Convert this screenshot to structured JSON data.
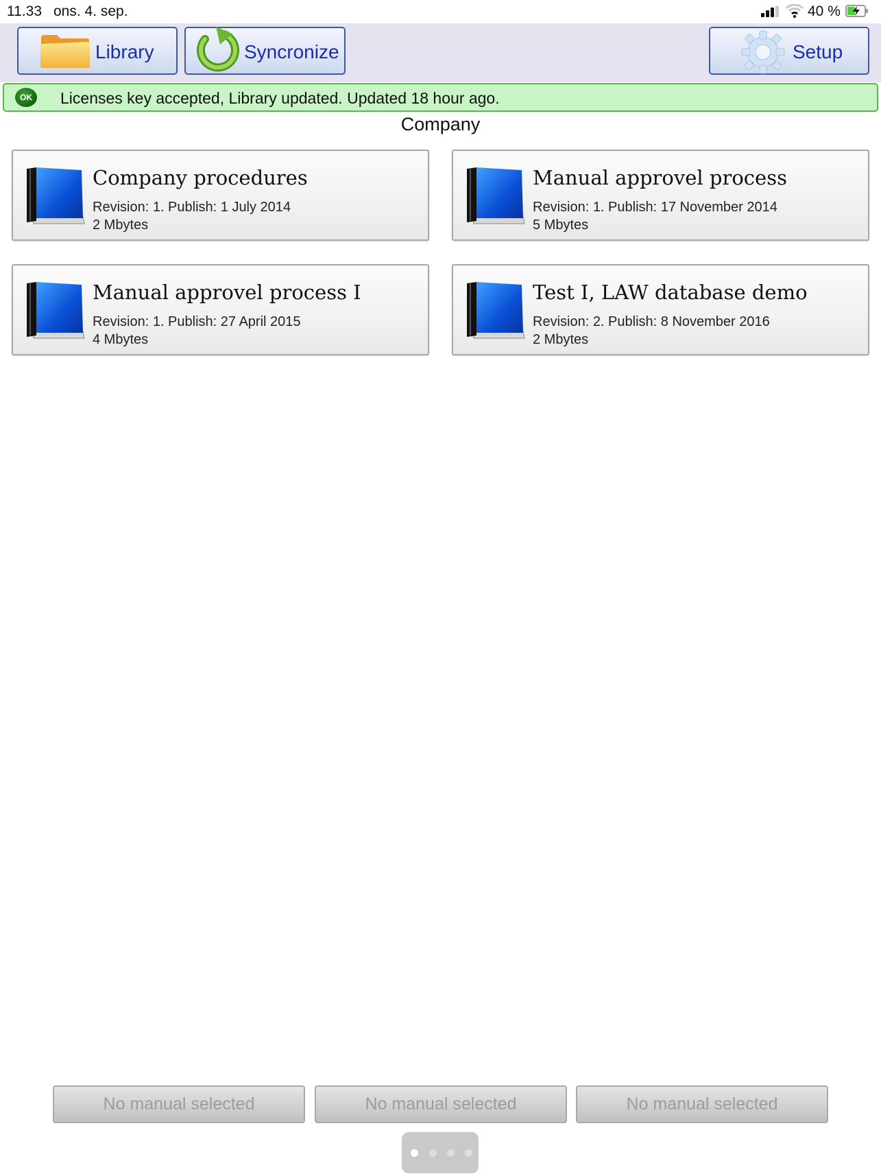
{
  "status_bar": {
    "time": "11.33",
    "date": "ons. 4. sep.",
    "battery": "40 %"
  },
  "toolbar": {
    "library_label": "Library",
    "sync_label": "Syncronize",
    "setup_label": "Setup"
  },
  "banner": {
    "badge": "OK",
    "message": "Licenses key accepted, Library updated. Updated 18 hour ago."
  },
  "section_title": "Company",
  "manuals": [
    {
      "title": "Company procedures",
      "revision": "Revision: 1. Publish: 1 July 2014",
      "size": "2 Mbytes"
    },
    {
      "title": "Manual approvel process",
      "revision": "Revision: 1. Publish: 17 November 2014",
      "size": "5 Mbytes"
    },
    {
      "title": "Manual approvel process I",
      "revision": "Revision: 1. Publish: 27 April 2015",
      "size": "4 Mbytes"
    },
    {
      "title": "Test I, LAW database demo",
      "revision": "Revision: 2. Publish: 8 November 2016",
      "size": "2 Mbytes"
    }
  ],
  "bottom_slots": [
    "No manual selected",
    "No manual selected",
    "No manual selected"
  ],
  "pager": {
    "pages": 4,
    "current": 1
  },
  "colors": {
    "accent_text": "#1a2fa5",
    "banner_bg": "#c9f5c6",
    "banner_border": "#58b84a",
    "toolbar_bg": "#e6e3f0"
  }
}
